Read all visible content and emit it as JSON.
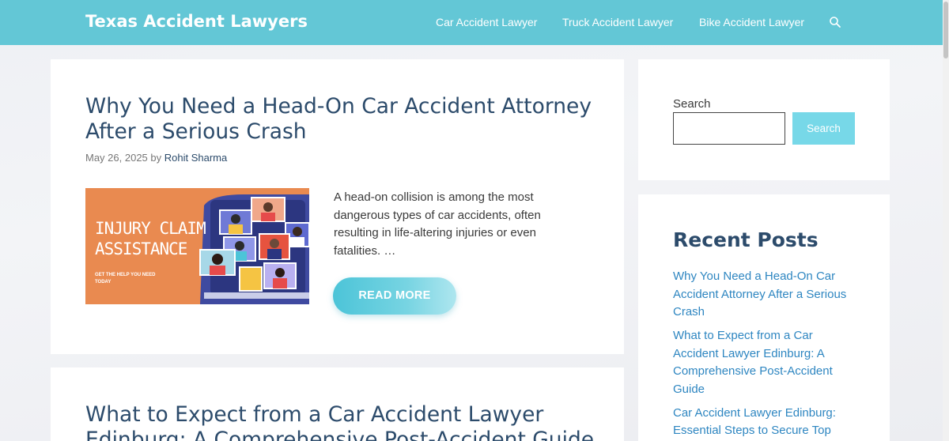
{
  "site": {
    "title": "Texas Accident Lawyers"
  },
  "nav": {
    "items": [
      {
        "label": "Car Accident Lawyer"
      },
      {
        "label": "Truck Accident Lawyer"
      },
      {
        "label": "Bike Accident Lawyer"
      }
    ],
    "search_icon": "search-icon"
  },
  "posts": [
    {
      "title_lines": [
        "Why You Need a Head-On Car Accident Attorney",
        "After a Serious Crash"
      ],
      "date": "May 26, 2025",
      "by": "by",
      "author": "Rohit Sharma",
      "thumbnail": {
        "title_lines": [
          "INJURY CLAIM",
          "ASSISTANCE"
        ],
        "subtitle_lines": [
          "GET THE HELP YOU NEED",
          "TODAY"
        ]
      },
      "excerpt": "A head-on collision is among the most dangerous types of car accidents, often resulting in life-altering injuries or even fatalities. …",
      "read_more": "READ MORE"
    },
    {
      "title_lines": [
        "What to Expect from a Car Accident Lawyer",
        "Edinburg: A Comprehensive Post-Accident Guide"
      ]
    }
  ],
  "sidebar": {
    "search": {
      "label": "Search",
      "button": "Search",
      "value": ""
    },
    "recent": {
      "title": "Recent Posts",
      "items": [
        "Why You Need a Head-On Car Accident Attorney After a Serious Crash",
        "What to Expect from a Car Accident Lawyer Edinburg: A Comprehensive Post-Accident Guide",
        "Car Accident Lawyer Edinburg: Essential Steps to Secure Top"
      ]
    }
  },
  "colors": {
    "header": "#63c7d6",
    "title": "#2c4b6b",
    "link": "#2e86c1",
    "thumb_bg": "#e98a50"
  }
}
